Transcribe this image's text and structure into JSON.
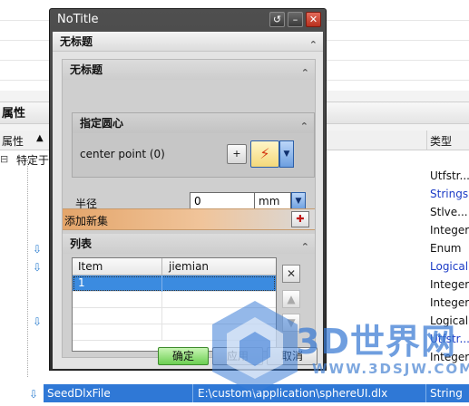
{
  "background": {
    "panel_title": "属性",
    "columns": {
      "property": "属性",
      "type": "类型"
    },
    "first_row_label": "特定于",
    "types": [
      "Utfstr...",
      "Strings",
      "Stlve...",
      "Integer",
      "Enum",
      "Logical",
      "Integer",
      "Integer",
      "Logical",
      "Utfstr...",
      "Integer"
    ],
    "selected_row": {
      "name": "SeedDlxFile",
      "value": "E:\\custom\\application\\sphereUI.dlx",
      "type": "String"
    }
  },
  "dialog": {
    "title": "NoTitle",
    "main_group": "无标题",
    "inner_group": "无标题",
    "point_group": {
      "title": "指定圆心",
      "label": "center point (0)"
    },
    "radius": {
      "label": "半径",
      "value": "0",
      "unit": "mm"
    },
    "add_set_label": "添加新集",
    "list": {
      "title": "列表",
      "columns": [
        "Item",
        "jiemian"
      ],
      "rows": [
        {
          "item": "1",
          "jiemian": ""
        }
      ]
    },
    "buttons": {
      "ok": "确定",
      "apply": "应用",
      "cancel": "取消"
    }
  },
  "watermark": {
    "main": "3D世界网",
    "url": "WWW.3DSJW.COM"
  }
}
